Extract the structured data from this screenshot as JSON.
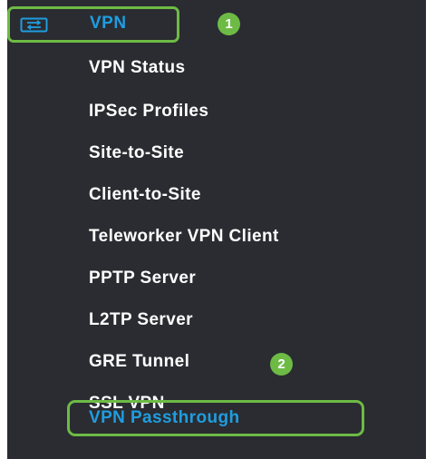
{
  "sidebar": {
    "section": {
      "label": "VPN",
      "icon": "vpn-icon",
      "callout_number": "1"
    },
    "items": [
      {
        "label": "VPN Status"
      },
      {
        "label": "IPSec Profiles"
      },
      {
        "label": "Site-to-Site"
      },
      {
        "label": "Client-to-Site"
      },
      {
        "label": "Teleworker VPN Client"
      },
      {
        "label": "PPTP Server"
      },
      {
        "label": "L2TP Server"
      },
      {
        "label": "GRE Tunnel",
        "callout_number": "2"
      },
      {
        "label": "SSL VPN"
      },
      {
        "label": "VPN Passthrough",
        "selected": true
      }
    ]
  },
  "colors": {
    "menu_background": "#2a2c31",
    "item_text": "#ffffff",
    "accent_blue": "#1f9de0",
    "highlight_green": "#6dbb45"
  }
}
